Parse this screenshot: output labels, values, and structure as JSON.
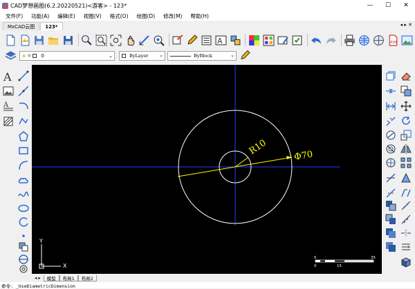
{
  "window": {
    "title": "CAD梦想画图(6.2.20220521)<游客> - 123*",
    "minimize": "—",
    "maximize": "☐",
    "close": "✕"
  },
  "menu": [
    "文件(F)",
    "功能(A)",
    "编辑(E)",
    "视图(V)",
    "格式(O)",
    "绘图(D)",
    "修改(M)",
    "帮助(H)"
  ],
  "tabs": {
    "home": "MxCAD云图",
    "active": "123*",
    "nav": "◂ ▸ ✕"
  },
  "properties": {
    "layer": "0",
    "linetype": "ByLayer",
    "lineweight": "ByBlock"
  },
  "drawing": {
    "radius_label": "R10",
    "diameter_label": "Φ70",
    "ucs_x": "X",
    "ucs_y": "Y",
    "scale_labels": [
      "0",
      "5",
      "15",
      "35"
    ],
    "colors": {
      "background": "#000000",
      "crosshair": "#2a3cff",
      "geometry": "#ffffff",
      "dimension": "#ffff00"
    }
  },
  "layout_tabs": [
    "模型",
    "布局1",
    "布局2"
  ],
  "layout_nav": "◂ ▸",
  "command_line": "命令: _UseDiametricDimension"
}
